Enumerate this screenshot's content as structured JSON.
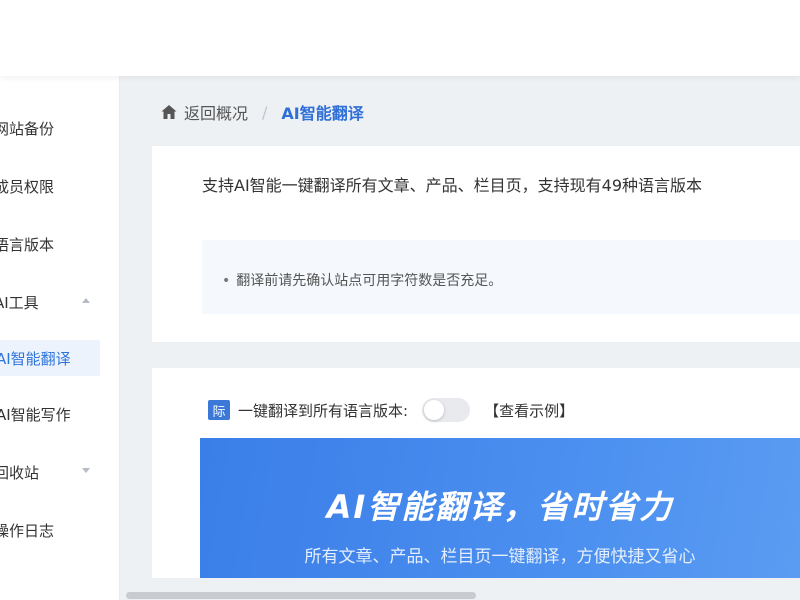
{
  "sidebar": {
    "items": [
      {
        "label": "网站备份"
      },
      {
        "label": "成员权限"
      },
      {
        "label": "语言版本"
      },
      {
        "label": "AI工具"
      },
      {
        "label": "AI智能翻译"
      },
      {
        "label": "AI智能写作"
      },
      {
        "label": "回收站"
      },
      {
        "label": "操作日志"
      }
    ]
  },
  "breadcrumb": {
    "back": "返回概况",
    "separator": "/",
    "current": "AI智能翻译"
  },
  "intro": {
    "description": "支持AI智能一键翻译所有文章、产品、栏目页，支持现有49种语言版本",
    "notice": "翻译前请先确认站点可用字符数是否充足。"
  },
  "translate_all": {
    "badge": "际",
    "label": "一键翻译到所有语言版本:",
    "toggle_on": false,
    "example_link": "【查看示例】"
  },
  "banner": {
    "title": "AI智能翻译，省时省力",
    "subtitle": "所有文章、产品、栏目页一键翻译，方便快捷又省心"
  },
  "colors": {
    "accent": "#2f6fd6",
    "banner": "#3a7ee8",
    "active_bg": "#ecf3fd"
  },
  "icons": [
    "home-icon",
    "chevron-up-icon",
    "chevron-down-icon",
    "link-icon"
  ]
}
